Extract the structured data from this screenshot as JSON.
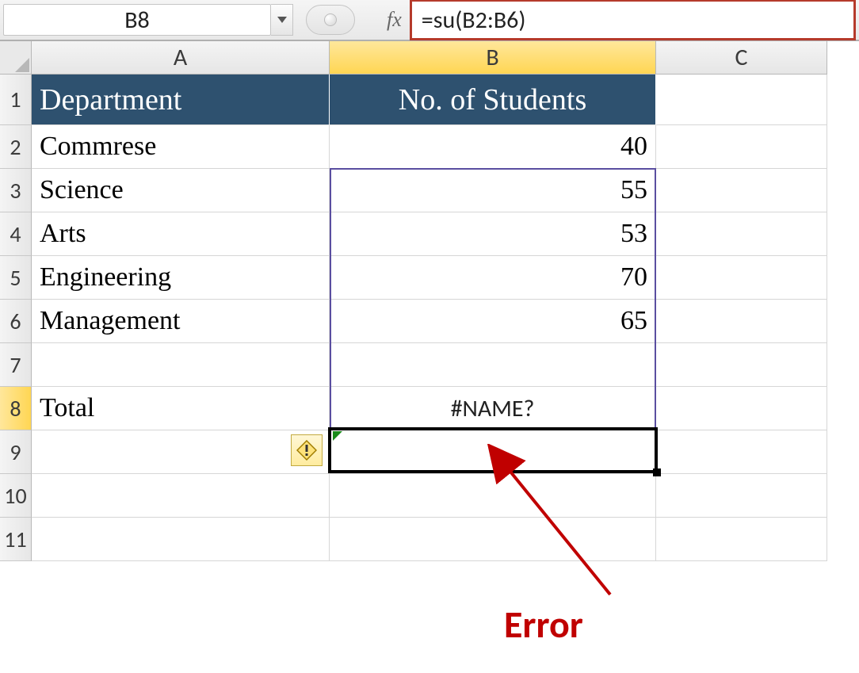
{
  "nameBox": "B8",
  "fxLabel": "fx",
  "formula": "=su(B2:B6)",
  "columns": {
    "A": "A",
    "B": "B",
    "C": "C"
  },
  "rowNums": [
    "1",
    "2",
    "3",
    "4",
    "5",
    "6",
    "7",
    "8",
    "9",
    "10",
    "11"
  ],
  "headers": {
    "dept": "Department",
    "students": "No. of Students"
  },
  "rows": [
    {
      "dept": "Commrese",
      "val": "40"
    },
    {
      "dept": "Science",
      "val": "55"
    },
    {
      "dept": "Arts",
      "val": "53"
    },
    {
      "dept": "Engineering",
      "val": "70"
    },
    {
      "dept": "Management",
      "val": "65"
    }
  ],
  "totalLabel": "Total",
  "errorValue": "#NAME?",
  "annotation": "Error",
  "chart_data": {
    "type": "table",
    "columns": [
      "Department",
      "No. of Students"
    ],
    "rows": [
      [
        "Commrese",
        40
      ],
      [
        "Science",
        55
      ],
      [
        "Arts",
        53
      ],
      [
        "Engineering",
        70
      ],
      [
        "Management",
        65
      ]
    ]
  }
}
